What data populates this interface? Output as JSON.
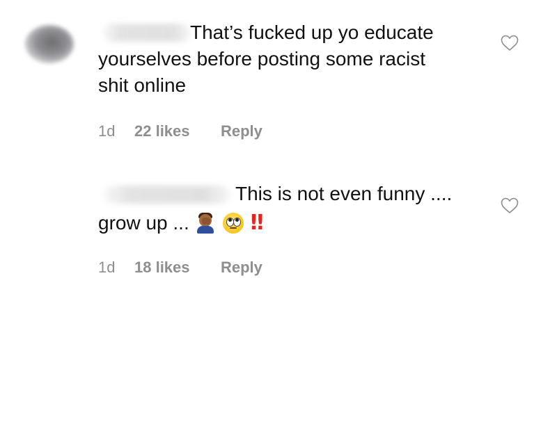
{
  "comments": [
    {
      "text_lines": [
        "That’s fucked up yo educate",
        "yourselves before posting some racist",
        "shit online"
      ],
      "time": "1d",
      "likes": "22 likes",
      "reply_label": "Reply",
      "like_icon": "heart-outline-icon"
    },
    {
      "text_lines": [
        "This is not even funny ....",
        "grow up ..."
      ],
      "emojis": [
        "facepalm-emoji",
        "face-with-rolling-eyes-emoji",
        "double-exclamation-emoji"
      ],
      "emoji_text": "‼",
      "time": "1d",
      "likes": "18 likes",
      "reply_label": "Reply",
      "like_icon": "heart-outline-icon"
    }
  ],
  "colors": {
    "text": "#111111",
    "meta": "#8e8e8e",
    "exclamation": "#e8221c"
  }
}
